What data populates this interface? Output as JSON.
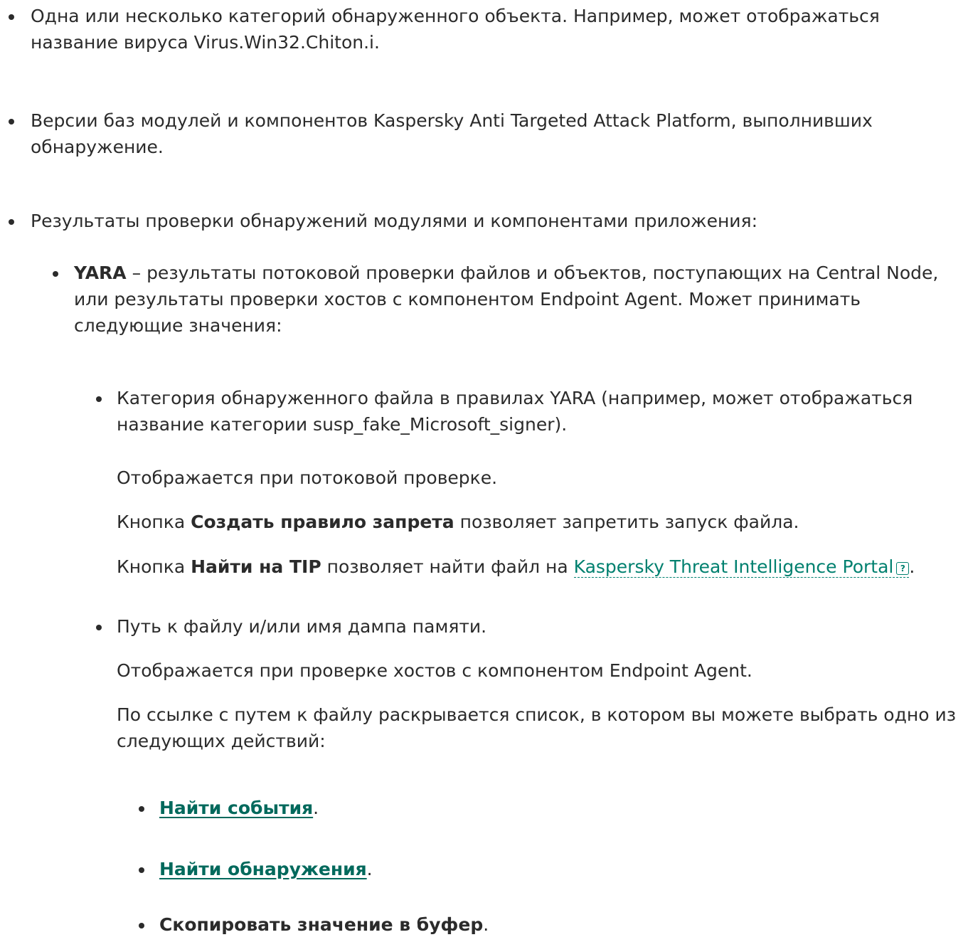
{
  "items": {
    "categories": "Одна или несколько категорий обнаруженного объекта. Например, может отображаться название вируса Virus.Win32.Chiton.i.",
    "versions": "Версии баз модулей и компонентов Kaspersky Anti Targeted Attack Platform, выполнивших обнаружение.",
    "results": "Результаты проверки обнаружений модулями и компонентами приложения:"
  },
  "yara": {
    "term": "YARA",
    "description": " – результаты потоковой проверки файлов и объектов, поступающих на Central Node, или результаты проверки хостов с компонентом Endpoint Agent. Может принимать следующие значения:",
    "category_item": "Категория обнаруженного файла в правилах YARA (например, может отображаться название категории susp_fake_Microsoft_signer).",
    "category_note": "Отображается при потоковой проверке.",
    "deny_prefix": "Кнопка ",
    "deny_button": "Создать правило запрета",
    "deny_suffix": " позволяет запретить запуск файла.",
    "tip_prefix": "Кнопка ",
    "tip_button": "Найти на TIP",
    "tip_middle": " позволяет найти файл на ",
    "tip_link": "Kaspersky Threat Intelligence Portal",
    "tip_help_icon": "?",
    "tip_suffix": ".",
    "path_item": "Путь к файлу и/или имя дампа памяти.",
    "path_note": "Отображается при проверке хостов с компонентом Endpoint Agent.",
    "path_list_intro": "По ссылке с путем к файлу раскрывается список, в котором вы можете выбрать одно из следующих действий:",
    "actions": [
      {
        "label": "Найти события",
        "suffix": "."
      },
      {
        "label": "Найти обнаружения",
        "suffix": "."
      },
      {
        "label": "Скопировать значение в буфер",
        "suffix": "."
      }
    ]
  },
  "colors": {
    "text": "#2b2b2b",
    "link": "#00695c",
    "link_dashed": "#00806f"
  }
}
